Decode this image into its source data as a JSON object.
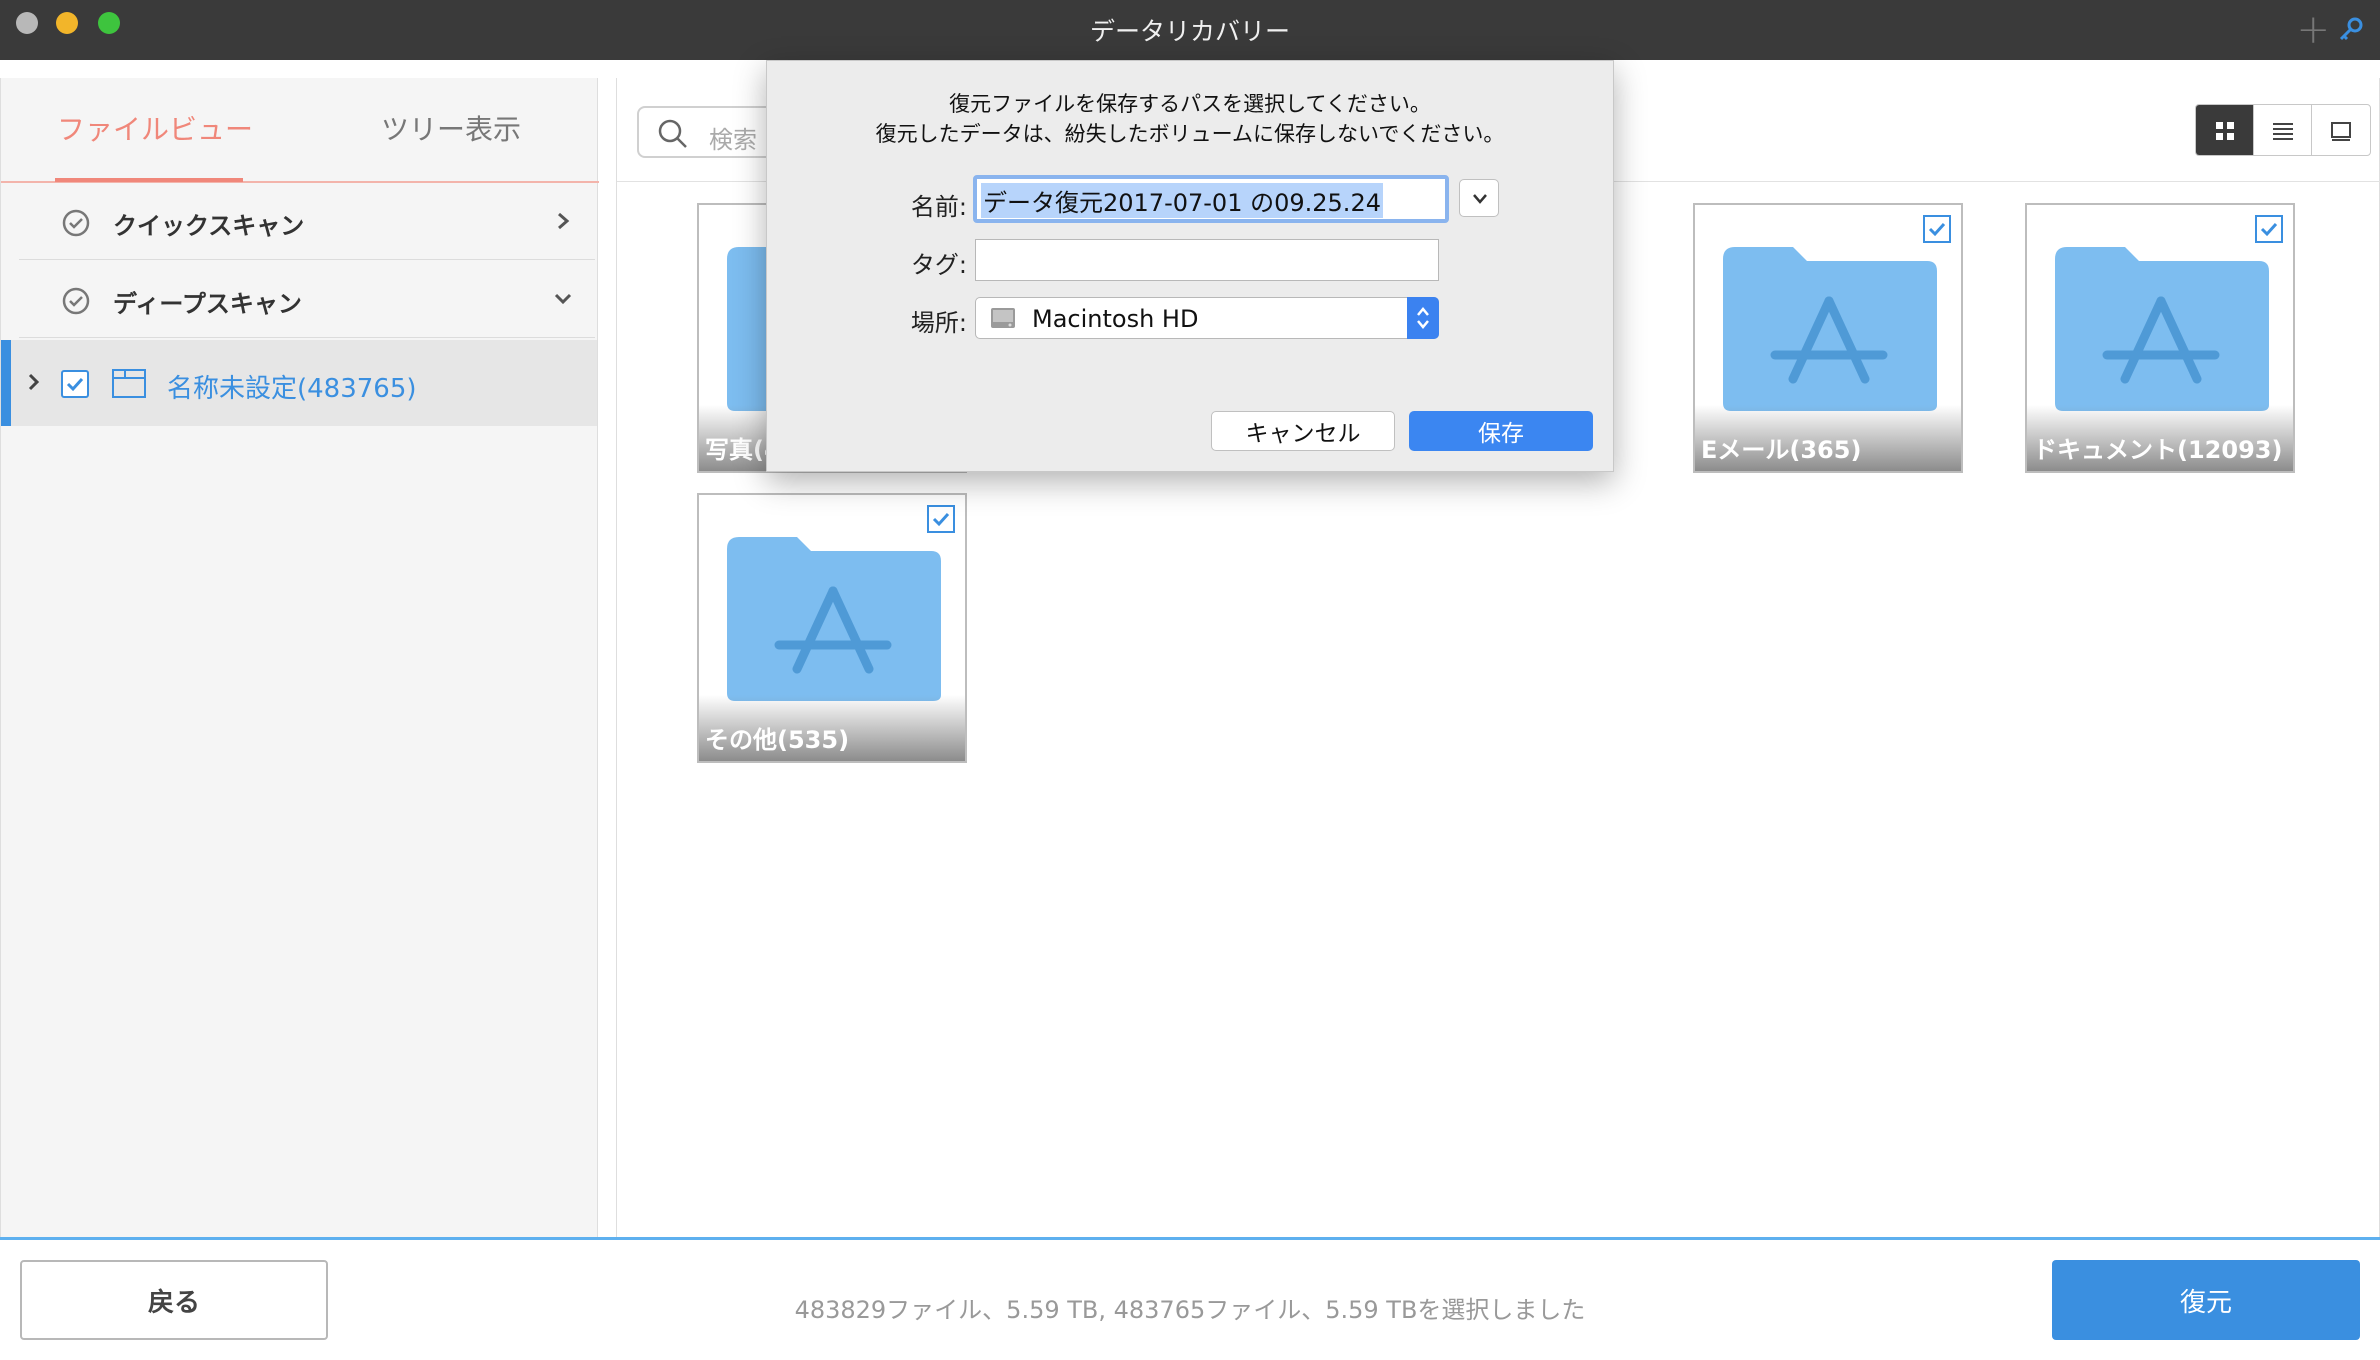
{
  "window": {
    "title": "データリカバリー"
  },
  "sidebar": {
    "tabs": [
      {
        "label": "ファイルビュー"
      },
      {
        "label": "ツリー表示"
      }
    ],
    "scans": [
      {
        "label": "クイックスキャン"
      },
      {
        "label": "ディープスキャン"
      }
    ],
    "tree": {
      "label": "名称未設定(483765)"
    }
  },
  "search": {
    "placeholder": "検索"
  },
  "tiles": [
    {
      "caption": "写真(4"
    },
    {
      "caption": "Eメール(365)"
    },
    {
      "caption": "ドキュメント(12093)"
    },
    {
      "caption": "その他(535)"
    }
  ],
  "dialog": {
    "message_line1": "復元ファイルを保存するパスを選択してください。",
    "message_line2": "復元したデータは、紛失したボリュームに保存しないでください。",
    "name_label": "名前:",
    "name_value": "データ復元2017-07-01 の09.25.24",
    "tag_label": "タグ:",
    "tag_value": "",
    "location_label": "場所:",
    "location_value": "Macintosh HD",
    "cancel_label": "キャンセル",
    "save_label": "保存"
  },
  "bottom": {
    "back_label": "戻る",
    "status": "483829ファイル、5.59 TB, 483765ファイル、5.59 TBを選択しました",
    "restore_label": "復元"
  },
  "colors": {
    "accent": "#3a8fe0",
    "tab_active": "#f0877a",
    "folder": "#7dbdf0"
  },
  "icons": [
    "plus-icon",
    "key-icon",
    "check-circle-icon",
    "chevron-right-icon",
    "chevron-down-icon",
    "folder-icon",
    "search-icon",
    "grid-view-icon",
    "list-view-icon",
    "preview-view-icon",
    "disk-icon"
  ]
}
